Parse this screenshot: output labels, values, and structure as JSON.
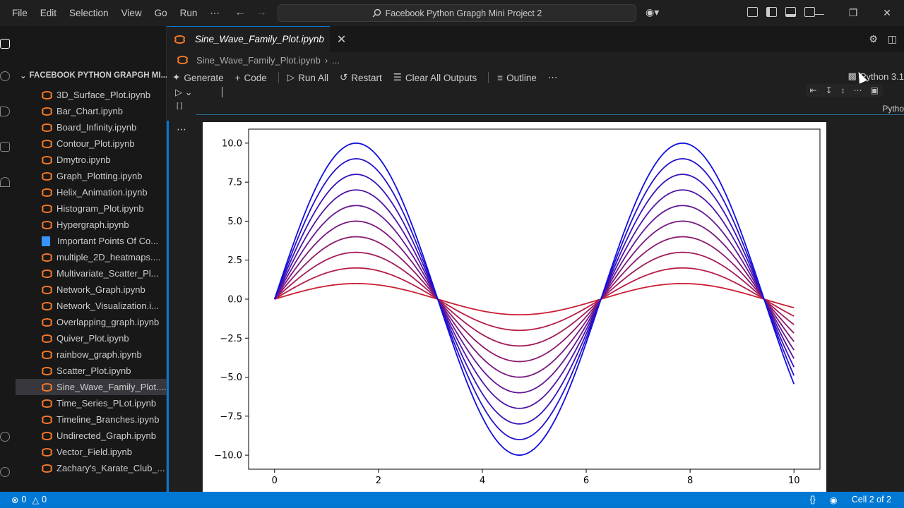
{
  "titlebar": {
    "menu": [
      "File",
      "Edit",
      "Selection",
      "View",
      "Go",
      "Run",
      "⋯"
    ],
    "search_text": "Facebook Python Grapgh Mini Project 2"
  },
  "sidebar": {
    "header": "FACEBOOK PYTHON GRAPGH MI...",
    "items": [
      {
        "label": "3D_Surface_Plot.ipynb",
        "icon": "notebook-icon"
      },
      {
        "label": "Bar_Chart.ipynb",
        "icon": "notebook-icon"
      },
      {
        "label": "Board_Infinity.ipynb",
        "icon": "notebook-icon"
      },
      {
        "label": "Contour_Plot.ipynb",
        "icon": "notebook-icon"
      },
      {
        "label": "Dmytro.ipynb",
        "icon": "notebook-icon"
      },
      {
        "label": "Graph_Plotting.ipynb",
        "icon": "notebook-icon"
      },
      {
        "label": "Helix_Animation.ipynb",
        "icon": "notebook-icon"
      },
      {
        "label": "Histogram_Plot.ipynb",
        "icon": "notebook-icon"
      },
      {
        "label": "Hypergraph.ipynb",
        "icon": "notebook-icon"
      },
      {
        "label": "Important Points Of Co...",
        "icon": "document-icon"
      },
      {
        "label": "multiple_2D_heatmaps....",
        "icon": "notebook-icon"
      },
      {
        "label": "Multivariate_Scatter_Pl...",
        "icon": "notebook-icon"
      },
      {
        "label": "Network_Graph.ipynb",
        "icon": "notebook-icon"
      },
      {
        "label": "Network_Visualization.i...",
        "icon": "notebook-icon"
      },
      {
        "label": "Overlapping_graph.ipynb",
        "icon": "notebook-icon"
      },
      {
        "label": "Quiver_Plot.ipynb",
        "icon": "notebook-icon"
      },
      {
        "label": "rainbow_graph.ipynb",
        "icon": "notebook-icon"
      },
      {
        "label": "Scatter_Plot.ipynb",
        "icon": "notebook-icon"
      },
      {
        "label": "Sine_Wave_Family_Plot....",
        "icon": "notebook-icon",
        "selected": true
      },
      {
        "label": "Time_Series_PLot.ipynb",
        "icon": "notebook-icon"
      },
      {
        "label": "Timeline_Branches.ipynb",
        "icon": "notebook-icon"
      },
      {
        "label": "Undirected_Graph.ipynb",
        "icon": "notebook-icon"
      },
      {
        "label": "Vector_Field.ipynb",
        "icon": "notebook-icon"
      },
      {
        "label": "Zachary's_Karate_Club_...",
        "icon": "notebook-icon"
      }
    ]
  },
  "editor": {
    "tab_title": "Sine_Wave_Family_Plot.ipynb",
    "breadcrumb_file": "Sine_Wave_Family_Plot.ipynb",
    "breadcrumb_more": "...",
    "toolbar": {
      "generate": "Generate",
      "code": "Code",
      "run_all": "Run All",
      "restart": "Restart",
      "clear_outputs": "Clear All Outputs",
      "outline": "Outline",
      "more": "⋯"
    },
    "kernel": "Python 3.1",
    "cell_language": "Pytho",
    "cell_exec": "[ ]"
  },
  "statusbar": {
    "errors": "0",
    "warnings": "0",
    "braces": "{}",
    "cell": "Cell 2 of 2"
  },
  "colors": {
    "accent": "#0078d4",
    "notebook_icon": "#f37726",
    "line_low": "#cc1f33",
    "line_high": "#1010e0"
  },
  "chart_data": {
    "type": "line",
    "function": "A * sin(x)",
    "x_range": [
      0,
      10
    ],
    "xlim": [
      -0.5,
      10.5
    ],
    "ylim": [
      -10.9,
      10.9
    ],
    "xticks": [
      "0",
      "2",
      "4",
      "6",
      "8",
      "10"
    ],
    "yticks": [
      "10.0",
      "7.5",
      "5.0",
      "2.5",
      "0.0",
      "−2.5",
      "−5.0",
      "−7.5",
      "−10.0"
    ],
    "series": [
      {
        "amplitude": 1
      },
      {
        "amplitude": 2
      },
      {
        "amplitude": 3
      },
      {
        "amplitude": 4
      },
      {
        "amplitude": 5
      },
      {
        "amplitude": 6
      },
      {
        "amplitude": 7
      },
      {
        "amplitude": 8
      },
      {
        "amplitude": 9
      },
      {
        "amplitude": 10
      }
    ],
    "grid": false,
    "legend": "none"
  }
}
